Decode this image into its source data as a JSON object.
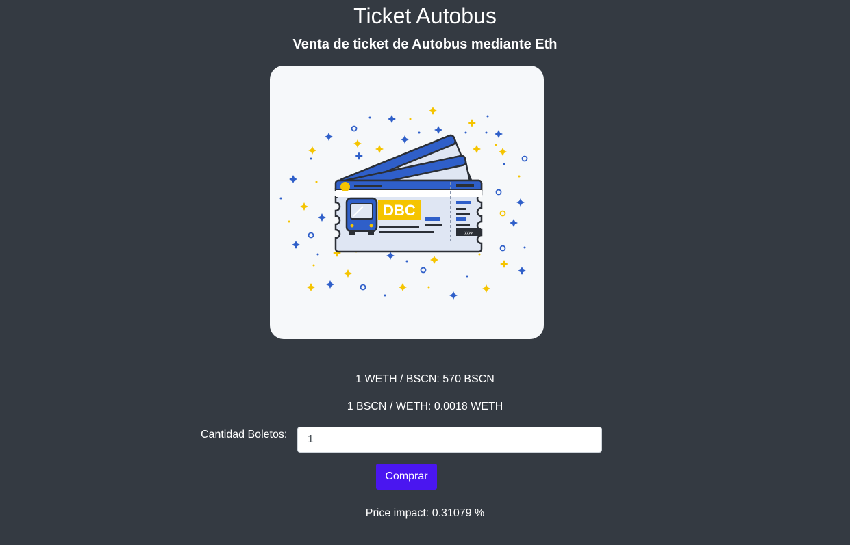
{
  "header": {
    "title": "Ticket Autobus",
    "subtitle": "Venta de ticket de Autobus mediante Eth"
  },
  "image": {
    "ticket_logo_text": "DBC",
    "colors": {
      "card_bg": "#f6f8fa",
      "ticket_blue": "#2f5fc9",
      "ticket_light": "#dfe6f3",
      "accent_yellow": "#f5c400",
      "outline": "#2b2f36"
    }
  },
  "rates": {
    "weth_to_bscn": "1 WETH / BSCN: 570 BSCN",
    "bscn_to_weth": "1 BSCN / WETH: 0.0018 WETH"
  },
  "form": {
    "quantity_label": "Cantidad Boletos:",
    "quantity_value": "1",
    "buy_label": "Comprar"
  },
  "status": {
    "price_impact": "Price impact: 0.31079 %"
  },
  "theme": {
    "background": "#343a42",
    "button": "#4a16f0"
  }
}
